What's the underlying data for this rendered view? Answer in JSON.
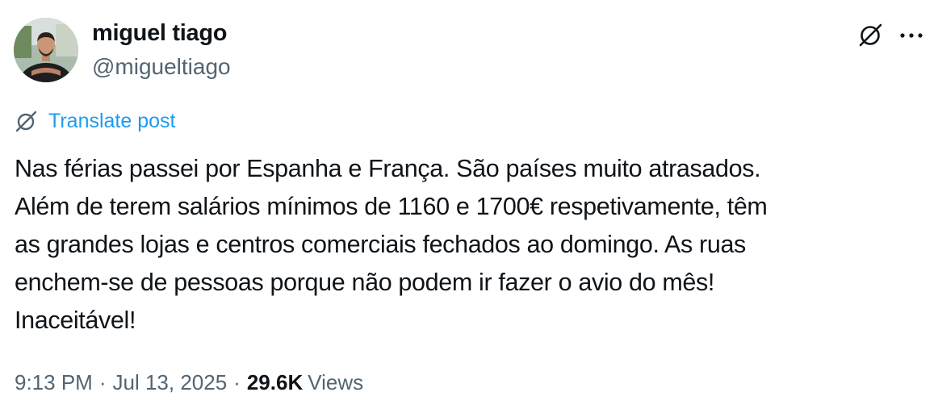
{
  "author": {
    "display_name": "miguel tiago",
    "handle": "@migueltiago",
    "avatar_icon": "profile-photo"
  },
  "actions": {
    "grok_icon": "grok-icon",
    "more_icon": "more-icon"
  },
  "translate": {
    "label": "Translate post",
    "icon": "grok-icon",
    "color": "#1d9bf0"
  },
  "post": {
    "lines": [
      "Nas férias passei por Espanha e França. São países muito atrasados.",
      "Além de terem salários mínimos de 1160 e 1700€ respetivamente, têm",
      "as grandes lojas e centros comerciais fechados ao domingo. As ruas",
      "enchem-se de pessoas porque não podem ir fazer o avio do mês!",
      "Inaceitável!"
    ]
  },
  "meta": {
    "time": "9:13 PM",
    "separator": "·",
    "date": "Jul 13, 2025",
    "views_count": "29.6K",
    "views_label": "Views"
  },
  "colors": {
    "text_primary": "#0f1419",
    "text_secondary": "#536471",
    "link": "#1d9bf0"
  }
}
